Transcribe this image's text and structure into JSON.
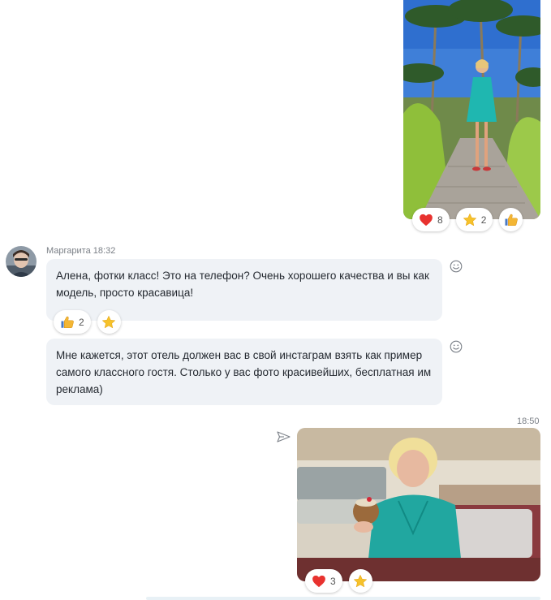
{
  "messages": {
    "top_photo": {
      "reactions": [
        {
          "icon": "heart-icon",
          "count": "8"
        },
        {
          "icon": "star-icon",
          "count": "2"
        },
        {
          "icon": "thumbs-up-icon",
          "count": ""
        }
      ]
    },
    "margarita_1": {
      "author": "Маргарита",
      "time": "18:32",
      "text": "Алена, фотки класс! Это на телефон? Очень хорошего качества и вы как модель, просто красавица!",
      "reactions": [
        {
          "icon": "thumbs-up-icon",
          "count": "2"
        },
        {
          "icon": "star-icon",
          "count": ""
        }
      ]
    },
    "margarita_2": {
      "text": "Мне кажется, этот отель должен вас в свой инстаграм взять как пример самого классного гостя. Столько у вас фото красивейших, бесплатная им реклама)"
    },
    "sent_photo": {
      "time": "18:50",
      "reactions": [
        {
          "icon": "heart-icon",
          "count": "3"
        },
        {
          "icon": "star-icon",
          "count": ""
        }
      ]
    }
  },
  "colors": {
    "bubble_bg": "#eff2f6",
    "heart": "#e8322f",
    "star": "#f5c02a",
    "thumb": "#f3b634"
  }
}
